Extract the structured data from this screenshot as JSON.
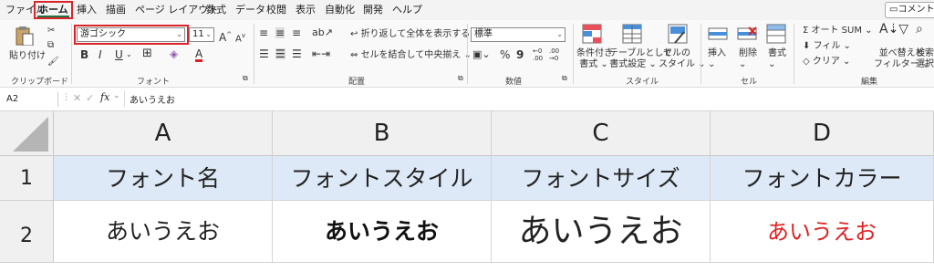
{
  "tabs": [
    "ファイル",
    "ホーム",
    "挿入",
    "描画",
    "ページ レイアウト",
    "数式",
    "データ",
    "校閲",
    "表示",
    "自動化",
    "開発",
    "ヘルプ"
  ],
  "comment_label": "コメント",
  "clipboard": {
    "paste": "貼り付け",
    "label": "クリップボード"
  },
  "font": {
    "name": "游ゴシック",
    "size": "11",
    "label": "フォント",
    "bold": "B",
    "italic": "I",
    "underline": "U",
    "grow": "A",
    "shrink": "A",
    "color_letter": "A"
  },
  "alignment": {
    "wrap": "折り返して全体を表示する",
    "merge": "セルを結合して中央揃え",
    "label": "配置"
  },
  "number": {
    "format": "標準",
    "label": "数値"
  },
  "styles": {
    "cond": "条件付き",
    "cond2": "書式",
    "table": "テーブルとして",
    "table2": "書式設定",
    "cell": "セルの",
    "cell2": "スタイル",
    "label": "スタイル"
  },
  "cells": {
    "insert": "挿入",
    "delete": "削除",
    "format": "書式",
    "label": "セル"
  },
  "editing": {
    "autosum": "オート SUM",
    "fill": "フィル",
    "clear": "クリア",
    "sort": "並べ替えと",
    "sort2": "フィルター",
    "find": "検索",
    "find2": "選択",
    "label": "編集"
  },
  "formula_bar": {
    "namebox": "A2",
    "fx": "fx",
    "content": "あいうえお"
  },
  "columns": [
    "A",
    "B",
    "C",
    "D"
  ],
  "rows": [
    "1",
    "2"
  ],
  "row1": [
    "フォント名",
    "フォントスタイル",
    "フォントサイズ",
    "フォントカラー"
  ],
  "row2": [
    "あいうえお",
    "あいうえお",
    "あいうえお",
    "あいうえお"
  ],
  "colors": {
    "red": "#e02020",
    "header_blue": "#dde9f7",
    "excel_green": "#1f7244"
  }
}
